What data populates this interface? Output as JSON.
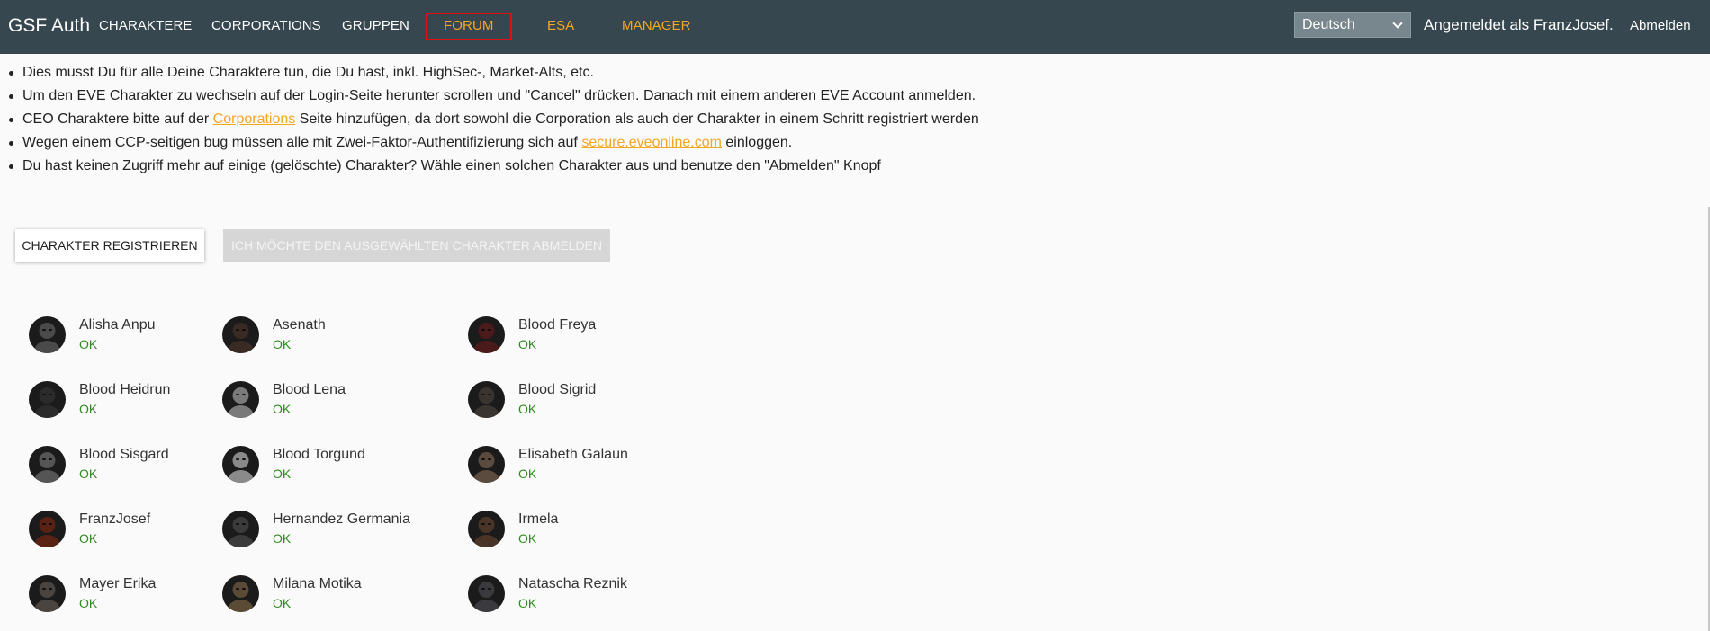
{
  "header": {
    "brand": "GSF Auth",
    "nav": [
      {
        "label": "Charaktere",
        "style": "white"
      },
      {
        "label": "Corporations",
        "style": "white"
      },
      {
        "label": "Gruppen",
        "style": "white"
      },
      {
        "label": "Forum",
        "style": "orange-boxed"
      },
      {
        "label": "ESA",
        "style": "orange"
      },
      {
        "label": "Manager",
        "style": "orange"
      }
    ],
    "language": "Deutsch",
    "logged_in_as": "Angemeldet als FranzJosef.",
    "logout": "Abmelden"
  },
  "info": {
    "item1": "Dies musst Du für alle Deine Charaktere tun, die Du hast, inkl. HighSec-, Market-Alts, etc.",
    "item2": "Um den EVE Charakter zu wechseln auf der Login-Seite herunter scrollen und \"Cancel\" drücken. Danach mit einem anderen EVE Account anmelden.",
    "item3_pre": "CEO Charaktere bitte auf der ",
    "item3_link": "Corporations",
    "item3_post": " Seite hinzufügen, da dort sowohl die Corporation als auch der Charakter in einem Schritt registriert werden",
    "item4_pre": "Wegen einem CCP-seitigen bug müssen alle mit Zwei-Faktor-Authentifizierung sich auf ",
    "item4_link": "secure.eveonline.com",
    "item4_post": " einloggen.",
    "item5": "Du hast keinen Zugriff mehr auf einige (gelöschte) Charakter? Wähle einen solchen Charakter aus und benutze den \"Abmelden\" Knopf"
  },
  "buttons": {
    "register": "Charakter registrieren",
    "unregister": "Ich möchte den ausgewählten Charakter abmelden"
  },
  "colors": {
    "header_bg": "#37474f",
    "accent_orange": "#f5a623",
    "status_ok": "#2e8b1e"
  },
  "characters": [
    {
      "name": "Alisha Anpu",
      "status": "OK",
      "tone": "#4a4a4a"
    },
    {
      "name": "Asenath",
      "status": "OK",
      "tone": "#3a2a24"
    },
    {
      "name": "Blood Freya",
      "status": "OK",
      "tone": "#4b1a1a"
    },
    {
      "name": "Blood Heidrun",
      "status": "OK",
      "tone": "#2b2b2b"
    },
    {
      "name": "Blood Lena",
      "status": "OK",
      "tone": "#7a7a7a"
    },
    {
      "name": "Blood Sigrid",
      "status": "OK",
      "tone": "#3a3430"
    },
    {
      "name": "Blood Sisgard",
      "status": "OK",
      "tone": "#555555"
    },
    {
      "name": "Blood Torgund",
      "status": "OK",
      "tone": "#8a8a8a"
    },
    {
      "name": "Elisabeth Galaun",
      "status": "OK",
      "tone": "#5b4a3e"
    },
    {
      "name": "FranzJosef",
      "status": "OK",
      "tone": "#5a2214"
    },
    {
      "name": "Hernandez Germania",
      "status": "OK",
      "tone": "#3b3b3b"
    },
    {
      "name": "Irmela",
      "status": "OK",
      "tone": "#4a3428"
    },
    {
      "name": "Mayer Erika",
      "status": "OK",
      "tone": "#4a4440"
    },
    {
      "name": "Milana Motika",
      "status": "OK",
      "tone": "#5a4a36"
    },
    {
      "name": "Natascha Reznik",
      "status": "OK",
      "tone": "#3a3a3e"
    }
  ]
}
